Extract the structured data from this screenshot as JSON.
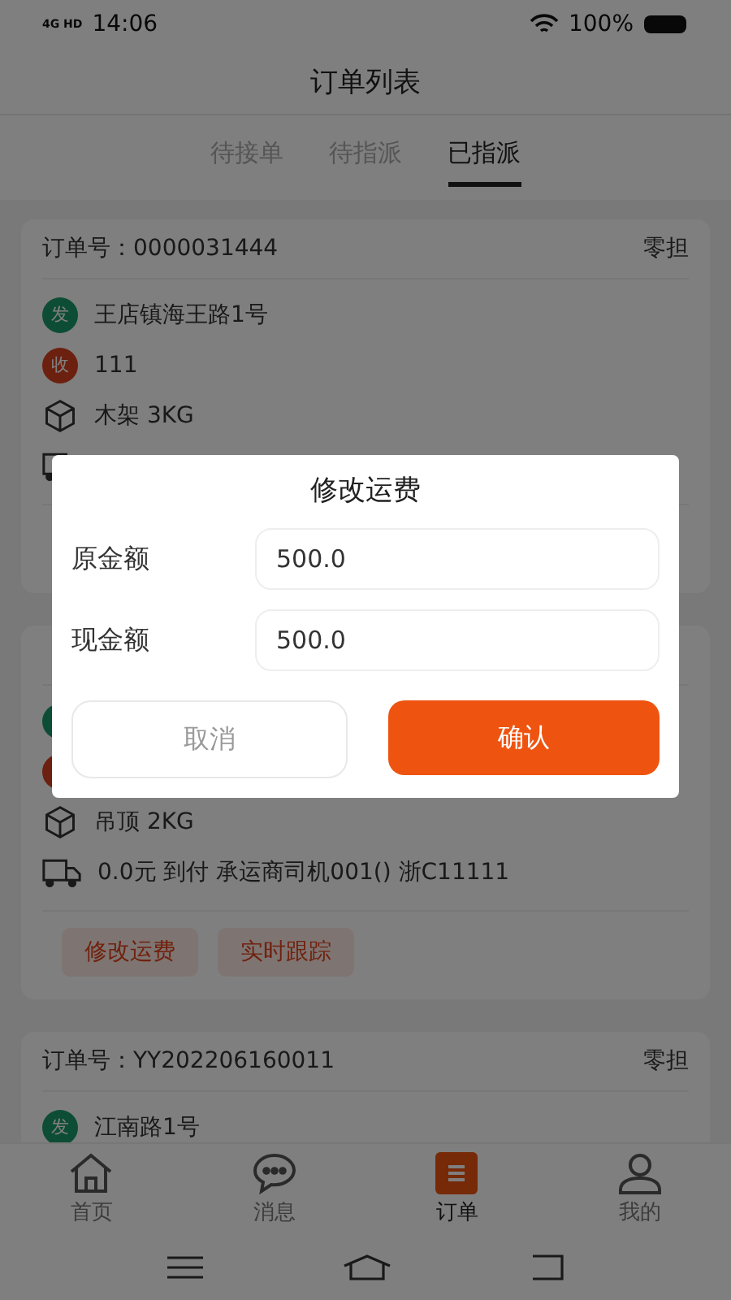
{
  "status_bar": {
    "time": "14:06",
    "network": "4G HD",
    "battery": "100%"
  },
  "header": {
    "title": "订单列表"
  },
  "tabs": [
    {
      "label": "待接单",
      "selected": false
    },
    {
      "label": "待指派",
      "selected": false
    },
    {
      "label": "已指派",
      "selected": true
    }
  ],
  "orders": [
    {
      "order_label": "订单号：",
      "order_no": "0000031444",
      "type": "零担",
      "rows": [
        {
          "kind": "sender",
          "badge": "发",
          "text": "王店镇海王路1号"
        },
        {
          "kind": "receiver",
          "badge": "收",
          "text": "111"
        },
        {
          "kind": "goods",
          "text": "木架  3KG"
        },
        {
          "kind": "fee"
        }
      ]
    },
    {
      "rows": [
        {
          "kind": "sender"
        },
        {
          "kind": "receiver"
        },
        {
          "kind": "goods",
          "text": "吊顶  2KG"
        },
        {
          "kind": "fee",
          "text": "0.0元  到付  承运商司机001()  浙C11111"
        }
      ],
      "actions": [
        "修改运费",
        "实时跟踪"
      ]
    },
    {
      "order_label": "订单号：",
      "order_no": "YY202206160011",
      "type": "零担",
      "rows": [
        {
          "kind": "sender",
          "badge": "发",
          "text": "江南路1号"
        }
      ]
    }
  ],
  "bottom_nav": [
    {
      "label": "首页",
      "selected": false
    },
    {
      "label": "消息",
      "selected": false
    },
    {
      "label": "订单",
      "selected": true
    },
    {
      "label": "我的",
      "selected": false
    }
  ],
  "dialog": {
    "title": "修改运费",
    "fields": [
      {
        "label": "原金额",
        "value": "500.0"
      },
      {
        "label": "现金额",
        "value": "500.0"
      }
    ],
    "cancel": "取消",
    "confirm": "确认"
  }
}
